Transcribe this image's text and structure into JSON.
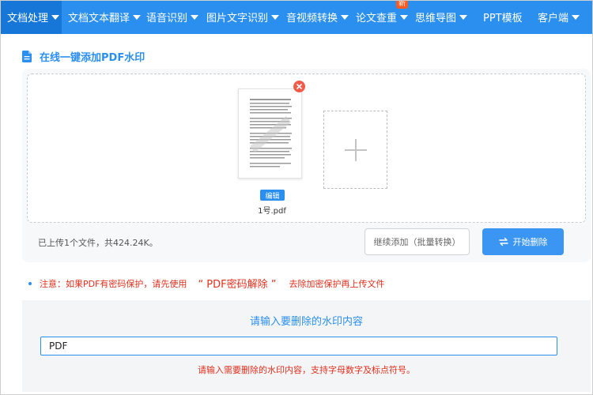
{
  "nav": {
    "items": [
      {
        "label": "文档处理",
        "active": true,
        "caret": true
      },
      {
        "label": "文档文本翻译",
        "caret": true
      },
      {
        "label": "语音识别",
        "caret": true
      },
      {
        "label": "图片文字识别",
        "caret": true
      },
      {
        "label": "音视频转换",
        "caret": true
      },
      {
        "label": "论文查重",
        "caret": true,
        "badge": "新"
      },
      {
        "label": "思维导图",
        "caret": true
      },
      {
        "label": "PPT模板",
        "caret": false
      },
      {
        "label": "客户端",
        "caret": true
      }
    ]
  },
  "page": {
    "title": "在线一键添加PDF水印",
    "icon": "document-icon"
  },
  "upload": {
    "file_name": "1号.pdf",
    "edit_label": "编辑",
    "summary": "已上传1个文件，共424.24K。",
    "continue_label": "继续添加（批量转换）",
    "start_label": "开始删除"
  },
  "notice": {
    "prefix": "注意：如果PDF有密码保护，请先使用",
    "link": "“ PDF密码解除 ”",
    "suffix": "去除加密保护再上传文件"
  },
  "watermark": {
    "heading": "请输入要删除的水印内容",
    "input_value": "PDF",
    "hint": "请输入需要删除的水印内容，支持字母数字及标点符号。"
  },
  "colors": {
    "primary": "#2b8ff0",
    "nav_active": "#1677d9",
    "danger": "#e0301e",
    "badge": "#ff5a1f"
  }
}
